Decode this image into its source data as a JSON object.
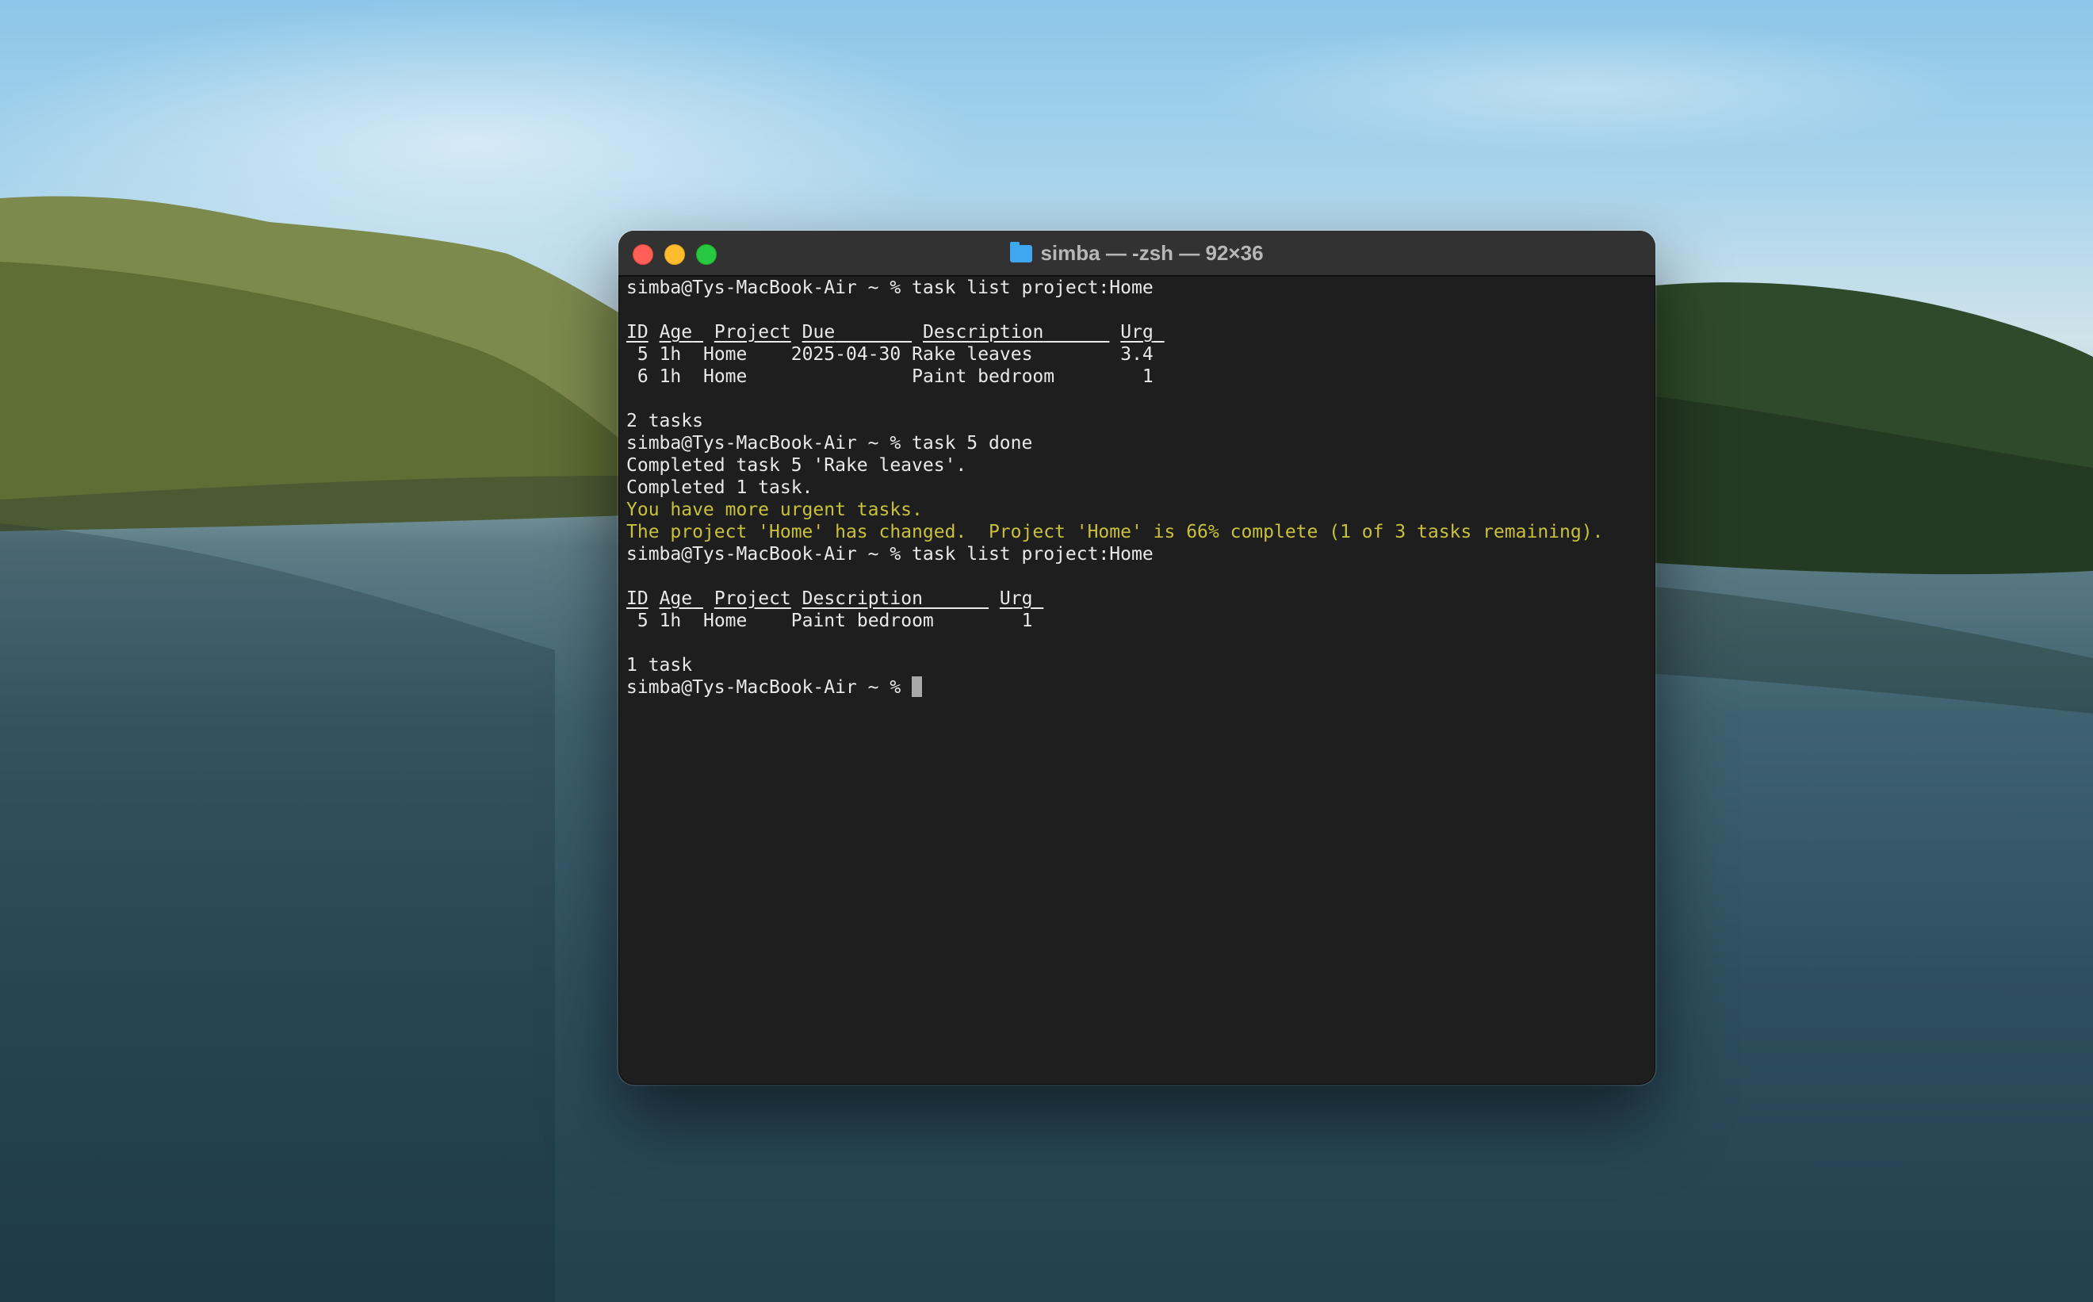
{
  "window": {
    "title": "simba — -zsh — 92×36"
  },
  "terminal": {
    "prompt": "simba@Tys-MacBook-Air ~ % ",
    "cmd1": "task list project:Home",
    "table1": {
      "headers": [
        "ID",
        "Age",
        "Project",
        "Due",
        "Description",
        "Urg"
      ],
      "rows": [
        [
          "5",
          "1h",
          "Home",
          "2025-04-30",
          "Rake leaves",
          "3.4"
        ],
        [
          "6",
          "1h",
          "Home",
          "",
          "Paint bedroom",
          "1"
        ]
      ]
    },
    "count1": "2 tasks",
    "cmd2": "task 5 done",
    "out_completed_task": "Completed task 5 'Rake leaves'.",
    "out_completed_count": "Completed 1 task.",
    "out_urgent": "You have more urgent tasks.",
    "out_project_changed": "The project 'Home' has changed.  Project 'Home' is 66% complete (1 of 3 tasks remaining).",
    "cmd3": "task list project:Home",
    "table2": {
      "headers": [
        "ID",
        "Age",
        "Project",
        "Description",
        "Urg"
      ],
      "rows": [
        [
          "5",
          "1h",
          "Home",
          "Paint bedroom",
          "1"
        ]
      ]
    },
    "count2": "1 task"
  },
  "colors": {
    "terminal_bg": "#1e1e1e",
    "text": "#e9e9e9",
    "warning_yellow": "#c8c13b"
  }
}
